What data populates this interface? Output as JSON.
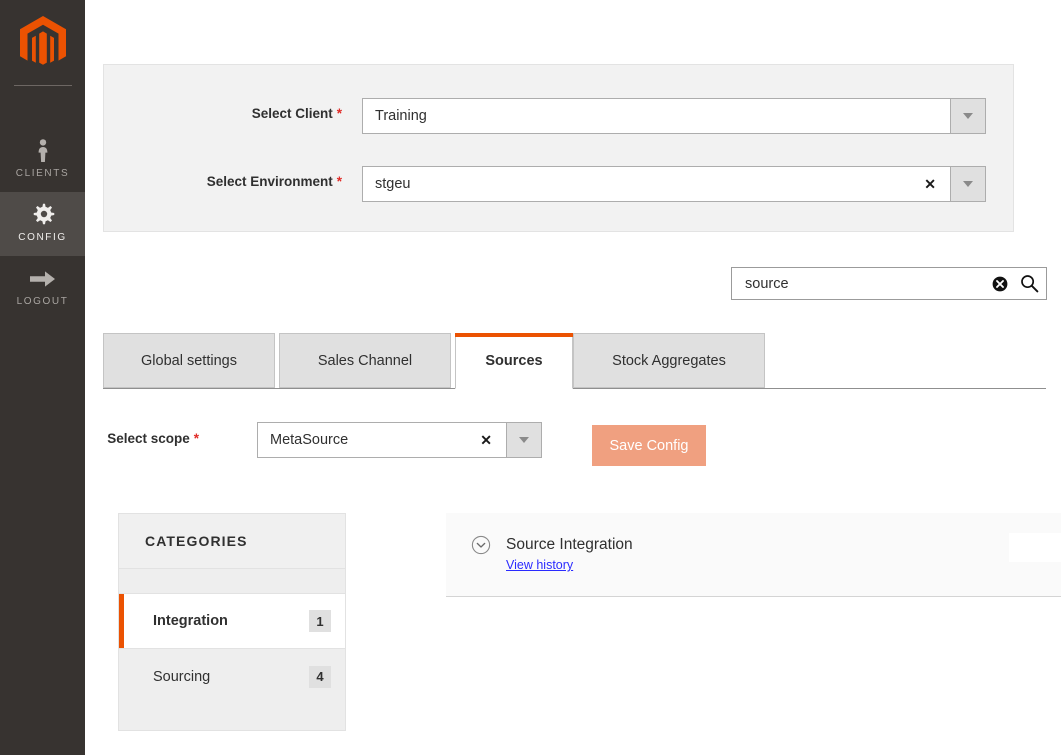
{
  "sidebar": {
    "logo_name": "magento-logo",
    "items": [
      {
        "label": "CLIENTS",
        "icon": "person-icon",
        "active": false
      },
      {
        "label": "CONFIG",
        "icon": "gear-icon",
        "active": true
      },
      {
        "label": "LOGOUT",
        "icon": "arrow-right-icon",
        "active": false
      }
    ]
  },
  "selector": {
    "client": {
      "label": "Select Client",
      "required": "*",
      "value": "Training",
      "clear": ""
    },
    "environment": {
      "label": "Select Environment",
      "required": "*",
      "value": "stgeu",
      "clear": "✕"
    }
  },
  "search": {
    "value": "source",
    "placeholder": "",
    "clear_icon": "clear-circle-icon",
    "search_icon": "search-icon"
  },
  "tabs": [
    {
      "label": "Global settings",
      "active": false
    },
    {
      "label": "Sales Channel",
      "active": false
    },
    {
      "label": "Sources",
      "active": true
    },
    {
      "label": "Stock Aggregates",
      "active": false
    }
  ],
  "scope": {
    "label": "Select scope",
    "required": "*",
    "value": "MetaSource",
    "clear": "✕",
    "save_label": "Save Config"
  },
  "categories": {
    "header": "CATEGORIES",
    "items": [
      {
        "name": "Integration",
        "count": "1",
        "active": true
      },
      {
        "name": "Sourcing",
        "count": "4",
        "active": false
      }
    ]
  },
  "section": {
    "title": "Source Integration",
    "history_link": "View history",
    "toggle_icon": "chevron-down-circle-icon"
  },
  "colors": {
    "accent_orange": "#eb5202",
    "sidebar_bg": "#373330",
    "sidebar_active": "#4f4b48",
    "required_red": "#e02b27",
    "link_blue": "#2a2aff",
    "save_button": "#f0a080"
  }
}
